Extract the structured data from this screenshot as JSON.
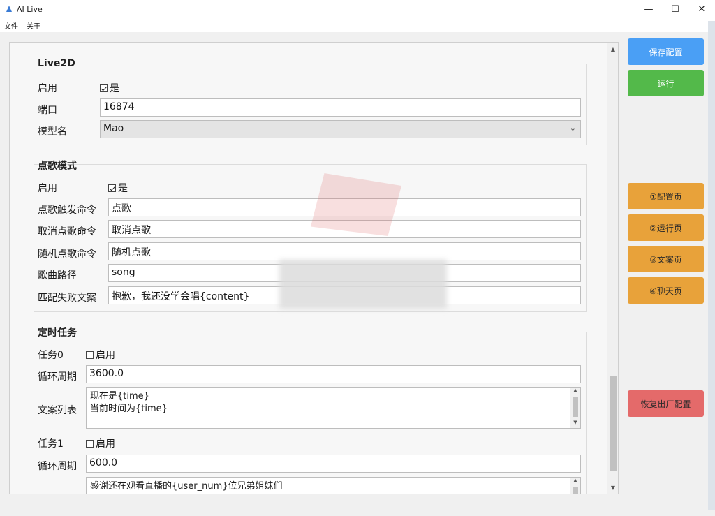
{
  "window": {
    "title": "AI Live",
    "controls": [
      "—",
      "☐",
      "✕"
    ]
  },
  "menu": {
    "items": [
      "文件",
      "关于"
    ]
  },
  "live2d": {
    "title": "Live2D",
    "enable_label": "启用",
    "enable_text": "是",
    "enable_checked": true,
    "port_label": "端口",
    "port_value": "16874",
    "model_label": "模型名",
    "model_value": "Mao"
  },
  "song": {
    "title": "点歌模式",
    "enable_label": "启用",
    "enable_text": "是",
    "enable_checked": true,
    "fields": [
      {
        "label": "点歌触发命令",
        "value": "点歌"
      },
      {
        "label": "取消点歌命令",
        "value": "取消点歌"
      },
      {
        "label": "随机点歌命令",
        "value": "随机点歌"
      },
      {
        "label": "歌曲路径",
        "value": "song"
      },
      {
        "label": "匹配失败文案",
        "value": "抱歉，我还没学会唱{content}"
      }
    ]
  },
  "schedule": {
    "title": "定时任务",
    "tasks": [
      {
        "name": "任务0",
        "enable_text": "启用",
        "enabled": false,
        "cycle_label": "循环周期",
        "cycle_value": "3600.0",
        "texts_label": "文案列表",
        "texts": [
          "现在是{time}",
          "当前时间为{time}"
        ]
      },
      {
        "name": "任务1",
        "enable_text": "启用",
        "enabled": false,
        "cycle_label": "循环周期",
        "cycle_value": "600.0",
        "texts": [
          "感谢还在观看直播的{user_num}位兄弟姐妹们"
        ]
      }
    ]
  },
  "side_buttons": {
    "save": "保存配置",
    "run": "运行",
    "page_config": "①配置页",
    "page_run": "②运行页",
    "page_copy": "③文案页",
    "page_chat": "④聊天页",
    "reset": "恢复出厂配置"
  },
  "colors": {
    "blue": "#4a9ff5",
    "green": "#53b94a",
    "orange": "#e8a23a",
    "red": "#e46a6a"
  }
}
